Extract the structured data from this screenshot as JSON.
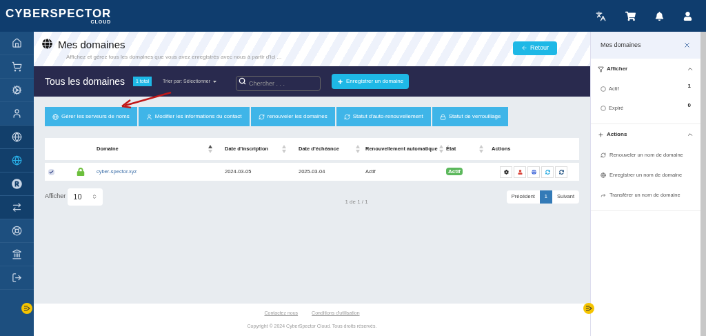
{
  "header": {
    "logo_main": "CYBERSPECTOR",
    "logo_sub": "CLOUD"
  },
  "sidebar": {
    "items": [
      {
        "selected": false,
        "kind": "main"
      },
      {
        "selected": false,
        "kind": "main"
      },
      {
        "selected": false,
        "kind": "main"
      },
      {
        "selected": false,
        "kind": "main"
      },
      {
        "selected": false,
        "kind": "sub"
      },
      {
        "selected": true,
        "kind": "sub"
      },
      {
        "selected": false,
        "kind": "sub"
      },
      {
        "selected": false,
        "kind": "sub"
      },
      {
        "selected": false,
        "kind": "main"
      },
      {
        "selected": false,
        "kind": "main"
      },
      {
        "selected": false,
        "kind": "main"
      }
    ]
  },
  "page": {
    "title": "Mes domaines",
    "subtitle": "Affichez et gérez tous les domaines que vous avez enregistrés avec nous à partir d'ici ...",
    "back_button": "Retour"
  },
  "toolbar": {
    "title": "Tous les domaines",
    "count_badge": "1 total",
    "sort": "Trier par: Sélectionner",
    "search": {
      "placeholder": "Chercher . . ."
    },
    "register_button": "Enregistrer un domaine"
  },
  "bulk_actions": [
    "Gérer les serveurs de noms",
    "Modifier les informations du contact",
    "renouveler les domaines",
    "Statut d'auto-renouvellement",
    "Statut de verrouillage"
  ],
  "table": {
    "columns": [
      "Domaine",
      "Date d'inscription",
      "Date d'échéance",
      "Renouvellement automatique",
      "État",
      "Actions"
    ],
    "rows": [
      {
        "checked": true,
        "domain": "cyber-spector.xyz",
        "registered": "2024-03-05",
        "expires": "2025-03-04",
        "auto_renew": "Actif",
        "status": "Actif"
      }
    ]
  },
  "pagination": {
    "show_label": "Afficher",
    "page_size": "10",
    "summary": "1 de 1 / 1",
    "prev": "Précédent",
    "pages": [
      {
        "label": "1",
        "selected": true
      }
    ],
    "next": "Suivant"
  },
  "footer": {
    "links": [
      "Contactez nous",
      "Conditions d'utilisation"
    ],
    "copyright": "Copyright © 2024 CyberSpector Cloud. Tous droits réservés."
  },
  "right_panel": {
    "title": "Mes domaines",
    "sections": [
      {
        "title": "Afficher",
        "kind": "filter",
        "expanded": true,
        "items": [
          {
            "label": "Actif",
            "count": "1",
            "selected": false
          },
          {
            "label": "Expiré",
            "count": "0",
            "selected": false
          }
        ]
      },
      {
        "title": "Actions",
        "kind": "actions",
        "expanded": true,
        "items": [
          {
            "label": "Renouveler un nom de domaine"
          },
          {
            "label": "Enregistrer un nom de domaine"
          },
          {
            "label": "Transférer un nom de domaine"
          }
        ]
      }
    ]
  }
}
